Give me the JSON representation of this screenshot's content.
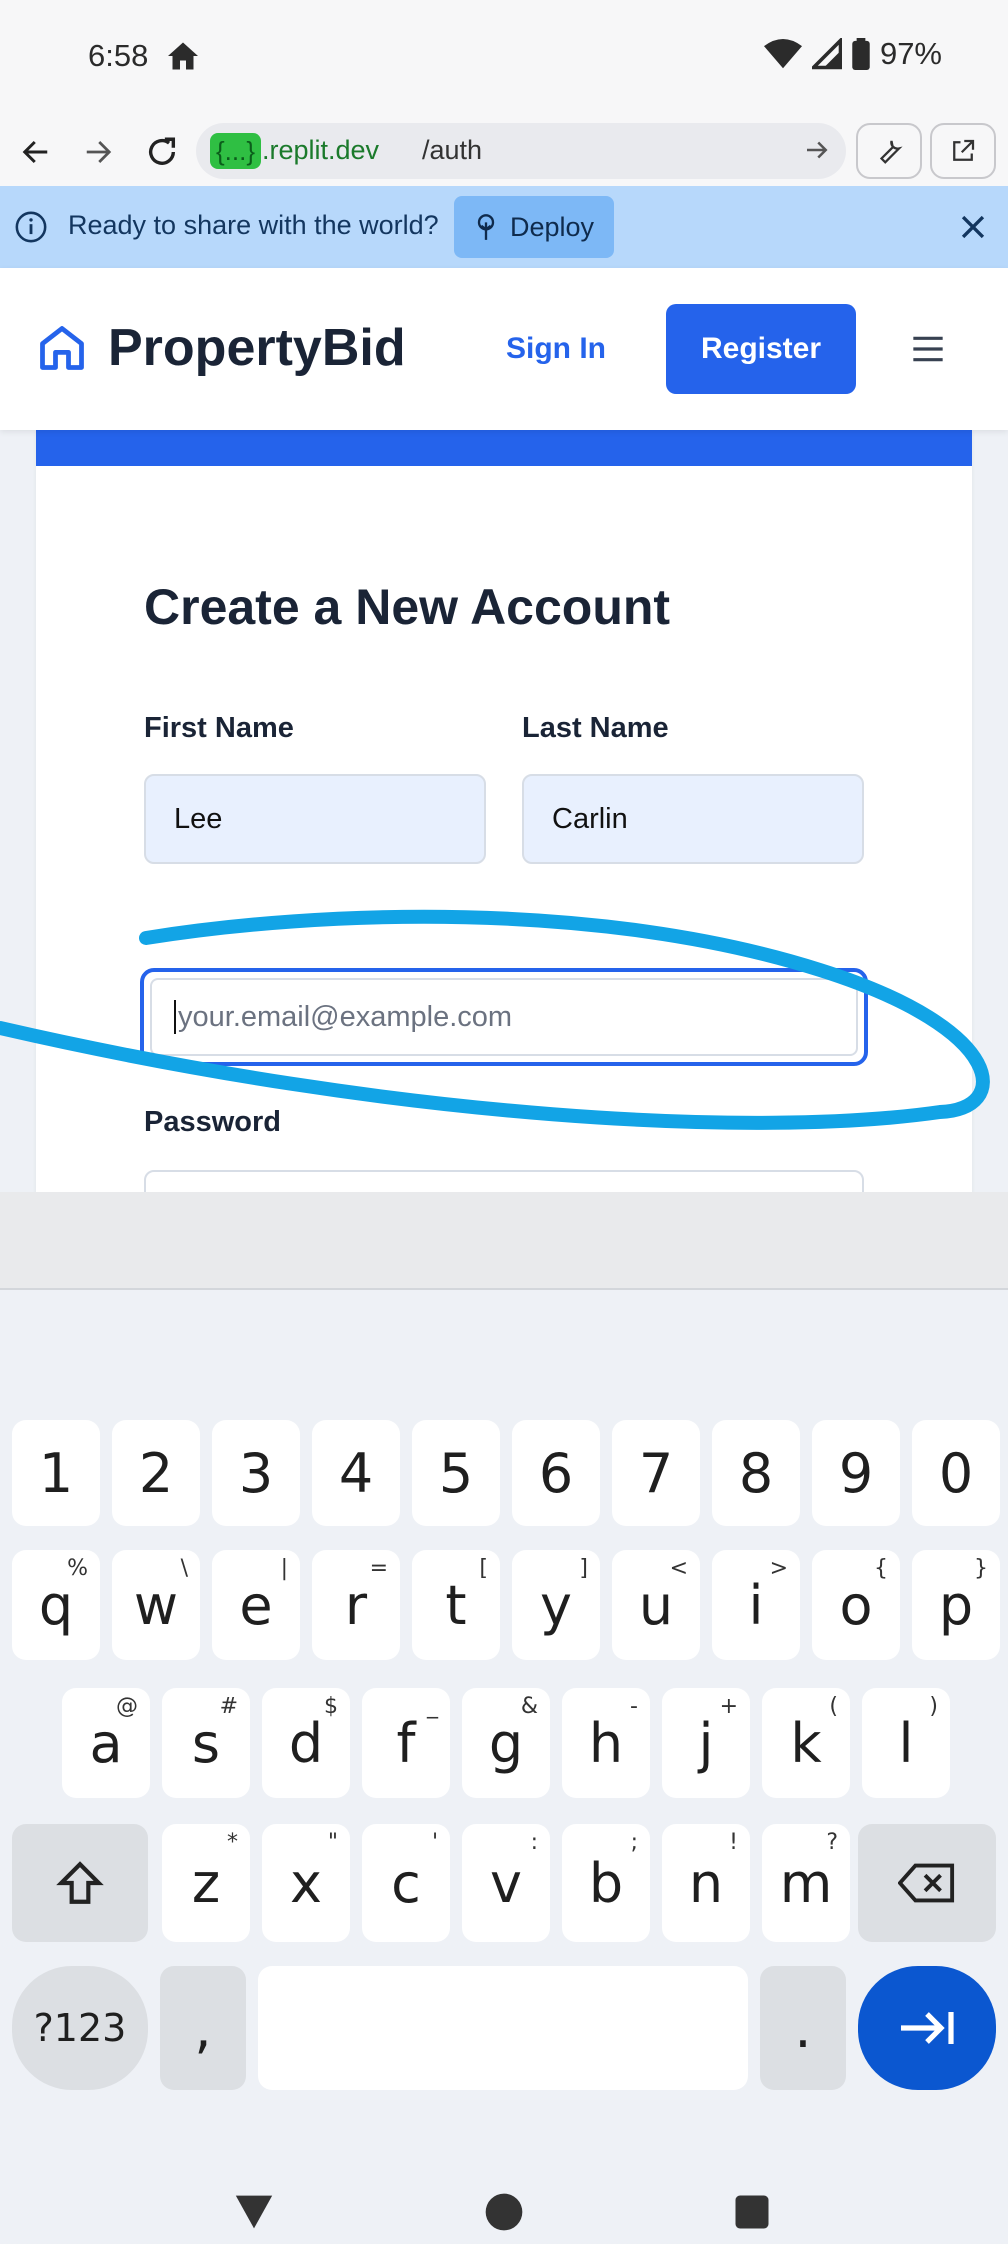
{
  "status_bar": {
    "time": "6:58",
    "battery": "97%"
  },
  "browser": {
    "url_domain_badge": "{...}",
    "url_domain_rest": ".replit.dev",
    "url_path": "/auth"
  },
  "banner": {
    "text": "Ready to share with the world?",
    "deploy_label": "Deploy"
  },
  "header": {
    "brand": "PropertyBid",
    "signin": "Sign In",
    "register": "Register"
  },
  "form": {
    "title": "Create a New Account",
    "first_name_label": "First Name",
    "first_name_value": "Lee",
    "last_name_label": "Last Name",
    "last_name_value": "Carlin",
    "email_placeholder": "your.email@example.com",
    "password_label": "Password"
  },
  "keyboard": {
    "row_numbers": [
      "1",
      "2",
      "3",
      "4",
      "5",
      "6",
      "7",
      "8",
      "9",
      "0"
    ],
    "row1": [
      {
        "k": "q",
        "h": "%"
      },
      {
        "k": "w",
        "h": "\\"
      },
      {
        "k": "e",
        "h": "|"
      },
      {
        "k": "r",
        "h": "="
      },
      {
        "k": "t",
        "h": "["
      },
      {
        "k": "y",
        "h": "]"
      },
      {
        "k": "u",
        "h": "<"
      },
      {
        "k": "i",
        "h": ">"
      },
      {
        "k": "o",
        "h": "{"
      },
      {
        "k": "p",
        "h": "}"
      }
    ],
    "row2": [
      {
        "k": "a",
        "h": "@"
      },
      {
        "k": "s",
        "h": "#"
      },
      {
        "k": "d",
        "h": "$"
      },
      {
        "k": "f",
        "h": "_"
      },
      {
        "k": "g",
        "h": "&"
      },
      {
        "k": "h",
        "h": "-"
      },
      {
        "k": "j",
        "h": "+"
      },
      {
        "k": "k",
        "h": "("
      },
      {
        "k": "l",
        "h": ")"
      }
    ],
    "row3": [
      {
        "k": "z",
        "h": "*"
      },
      {
        "k": "x",
        "h": "\""
      },
      {
        "k": "c",
        "h": "'"
      },
      {
        "k": "v",
        "h": ":"
      },
      {
        "k": "b",
        "h": ";"
      },
      {
        "k": "n",
        "h": "!"
      },
      {
        "k": "m",
        "h": "?"
      }
    ],
    "symbols_label": "?123",
    "comma": ",",
    "period": "."
  }
}
